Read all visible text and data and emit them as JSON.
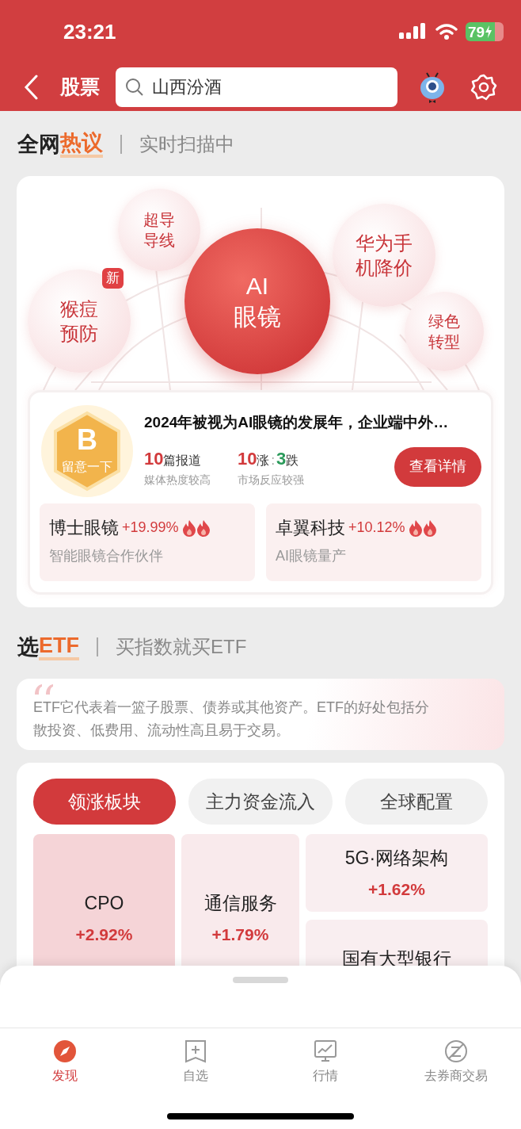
{
  "status_bar": {
    "time": "23:21",
    "battery": "79"
  },
  "nav": {
    "title": "股票",
    "search": {
      "value": "山西汾酒"
    }
  },
  "hot_section": {
    "title": "全网",
    "title_highlight": "热议",
    "subtitle": "实时扫描中",
    "bubbles": [
      {
        "label": "超导导线",
        "selected": false
      },
      {
        "label": "华为手机降价",
        "selected": false
      },
      {
        "label": "AI眼镜",
        "selected": true
      },
      {
        "label": "猴痘预防",
        "selected": false,
        "badge": "新"
      },
      {
        "label": "绿色转型",
        "selected": false
      }
    ],
    "detail": {
      "grade": "B",
      "grade_label": "留意一下",
      "headline": "2024年被视为AI眼镜的发展年，企业端中外…",
      "reports": {
        "count": "10",
        "unit": "篇报道",
        "note": "媒体热度较高"
      },
      "market": {
        "up": "10",
        "up_unit": "涨",
        "sep": ":",
        "down": "3",
        "down_unit": "跌",
        "note": "市场反应较强"
      },
      "button": "查看详情",
      "stocks": [
        {
          "name": "博士眼镜",
          "change": "+19.99%",
          "note": "智能眼镜合作伙伴"
        },
        {
          "name": "卓翼科技",
          "change": "+10.12%",
          "note": "AI眼镜量产"
        }
      ]
    }
  },
  "etf_section": {
    "title": "选",
    "title_highlight": "ETF",
    "subtitle": "买指数就买ETF",
    "quote": "ETF它代表着一篮子股票、债券或其他资产。ETF的好处包括分散投资、低费用、流动性高且易于交易。"
  },
  "sectors": {
    "tabs": [
      {
        "label": "领涨板块",
        "selected": true
      },
      {
        "label": "主力资金流入",
        "selected": false
      },
      {
        "label": "全球配置",
        "selected": false
      }
    ],
    "tiles": [
      {
        "name": "CPO",
        "change": "+2.92%",
        "color": "#f5d4d7"
      },
      {
        "name": "通信服务",
        "change": "+1.79%",
        "color": "#f9eaec"
      },
      {
        "name": "5G·网络架构",
        "change": "+1.62%",
        "color": "#f9eef0"
      },
      {
        "name": "国有大型银行",
        "color": "#f9eef0"
      }
    ]
  },
  "tab_bar": [
    {
      "label": "发现",
      "selected": true
    },
    {
      "label": "自选",
      "selected": false
    },
    {
      "label": "行情",
      "selected": false
    },
    {
      "label": "去券商交易",
      "selected": false
    }
  ]
}
